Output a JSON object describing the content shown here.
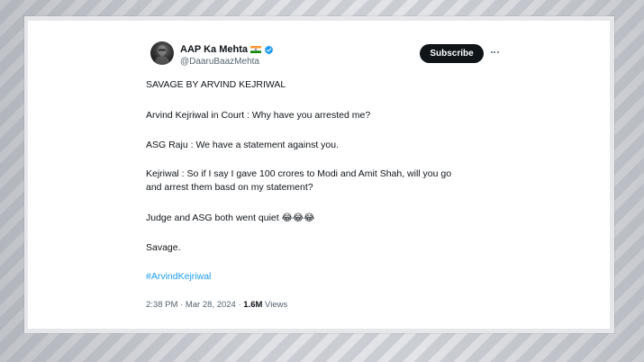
{
  "colors": {
    "accent": "#1d9bf0",
    "text_primary": "#0f1419",
    "text_secondary": "#536471",
    "button_bg": "#0f1419"
  },
  "author": {
    "display_name": "AAP Ka Mehta",
    "handle": "@DaaruBaazMehta",
    "flag_icon": "india-flag-icon",
    "verified_icon": "verified-badge-icon"
  },
  "actions": {
    "subscribe_label": "Subscribe",
    "more_icon": "more-options-icon"
  },
  "tweet": {
    "line1": "SAVAGE BY ARVIND KEJRIWAL",
    "line2": "Arvind Kejriwal in Court : Why have you arrested me?",
    "line3": "ASG  Raju : We have a statement against you.",
    "line4": "Kejriwal : So if I say I gave 100 crores to Modi and Amit Shah, will you go",
    "line5": "and arrest them basd on my statement?",
    "line6": "Judge and ASG both went quiet 😂😂😂",
    "line7": "Savage.",
    "hashtag": "#ArvindKejriwal"
  },
  "meta": {
    "time": "2:38 PM",
    "date": "Mar 28, 2024",
    "views_count": "1.6M",
    "views_label": "Views"
  }
}
